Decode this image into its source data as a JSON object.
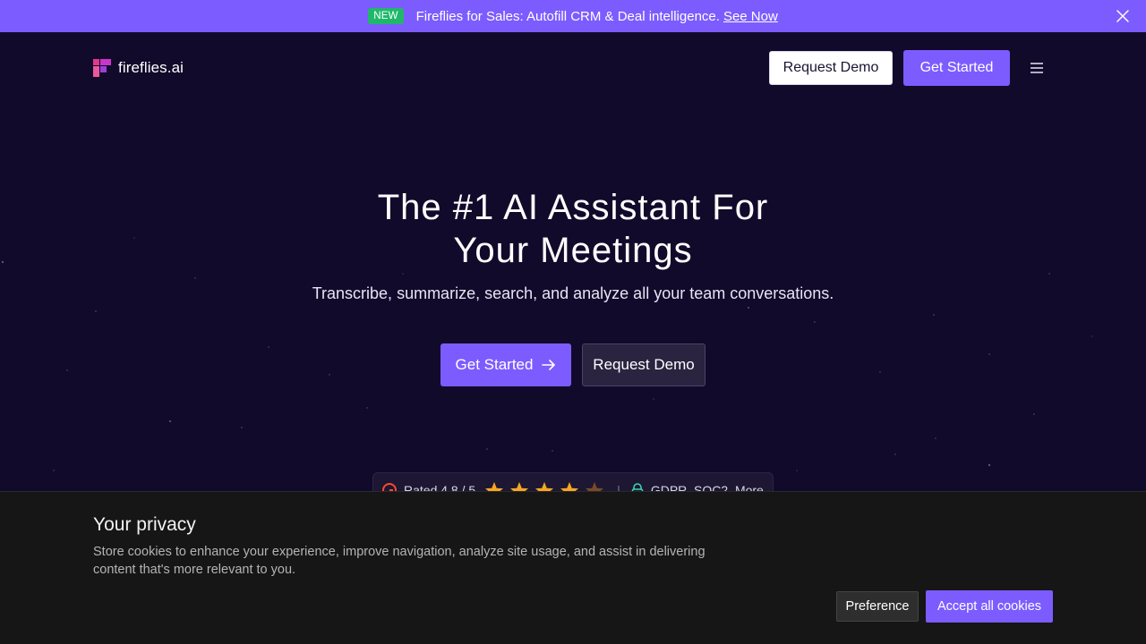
{
  "announcement": {
    "badge": "NEW",
    "text": "Fireflies for Sales: Autofill CRM & Deal intelligence.",
    "link": "See Now"
  },
  "header": {
    "logo_text": "fireflies.ai",
    "request_demo": "Request Demo",
    "get_started": "Get Started"
  },
  "hero": {
    "title_line1": "The #1 AI Assistant For",
    "title_line2": "Your Meetings",
    "subtitle": "Transcribe, summarize, search, and analyze all your team conversations.",
    "get_started": "Get Started",
    "request_demo": "Request Demo"
  },
  "rating": {
    "text": "Rated 4.8 / 5",
    "stars_filled": 4,
    "stars_total": 5,
    "separator": "|",
    "compliance": "GDPR, SOC2, More"
  },
  "cookie": {
    "title": "Your privacy",
    "text": "Store cookies to enhance your experience, improve navigation, analyze site usage, and assist in delivering content that's more relevant to you.",
    "preference": "Preference",
    "accept": "Accept all cookies"
  },
  "colors": {
    "accent": "#7c5cff",
    "background": "#120a2a",
    "badge": "#1fb86b",
    "star": "#f5a623",
    "cookie_bg": "#161616"
  },
  "icons": [
    "close-icon",
    "fireflies-logo-icon",
    "menu-icon",
    "arrow-right-icon",
    "g2-icon",
    "star-icon",
    "lock-icon"
  ]
}
